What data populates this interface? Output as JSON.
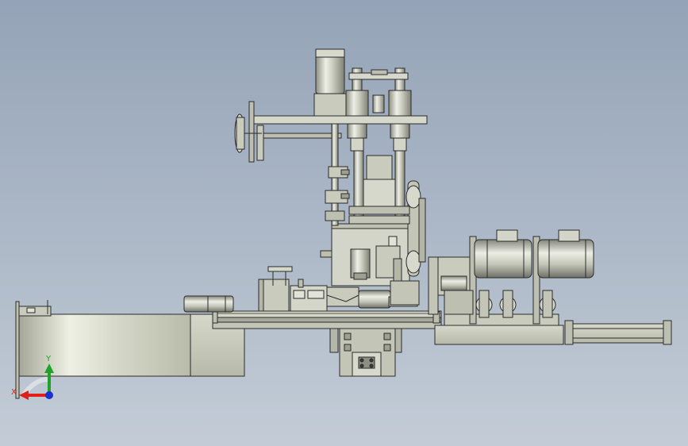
{
  "viewport": {
    "background_top": "#94a3b7",
    "background_bottom": "#c3ccd6"
  },
  "model": {
    "body_color": "#c9cbbd",
    "body_light": "#e2e3d8",
    "body_dark": "#9ea091",
    "edge_color": "#2b2b2b",
    "rail_color": "#8f9186"
  },
  "triad": {
    "x_label": "X",
    "y_label": "Y",
    "x_color": "#e0201b",
    "y_color": "#1fa22a",
    "z_color": "#1b2fd6"
  }
}
